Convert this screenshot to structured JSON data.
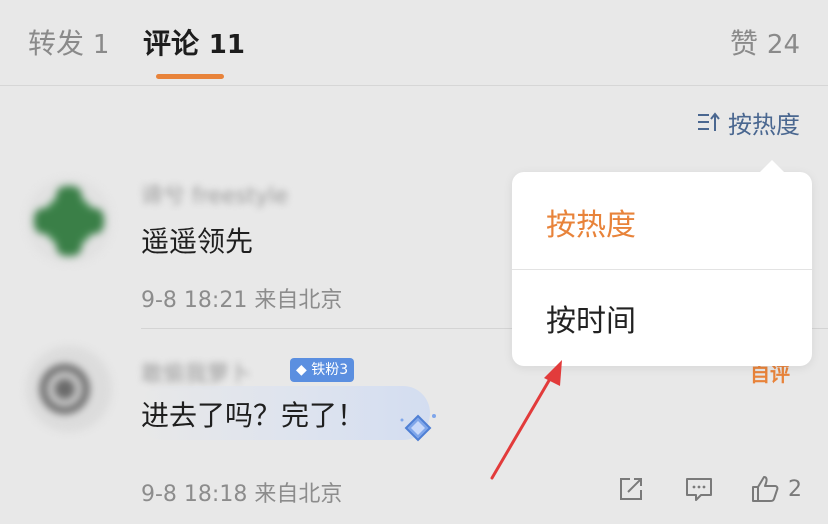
{
  "tabs": {
    "repost": {
      "label": "转发",
      "count": "1"
    },
    "comment": {
      "label": "评论",
      "count": "11"
    },
    "like": {
      "label": "赞",
      "count": "24"
    }
  },
  "sort": {
    "label": "按热度",
    "icon": "sort-icon"
  },
  "dropdown": {
    "items": [
      {
        "label": "按热度",
        "selected": true
      },
      {
        "label": "按时间",
        "selected": false
      }
    ]
  },
  "comments": [
    {
      "username": "谛兮 freestyle",
      "text": "遥遥领先",
      "meta": "9-8 18:21 来自北京"
    },
    {
      "username": "敢偷我萝卜",
      "badge": "铁粉3",
      "text": "进去了吗？完了！",
      "meta": "9-8 18:18 来自北京",
      "author_tag": "自评",
      "likes": "2"
    }
  ],
  "colors": {
    "accent": "#e8833a",
    "link": "#4a6790",
    "badge": "#5b8fe0",
    "annotation": "#e23b3b"
  }
}
